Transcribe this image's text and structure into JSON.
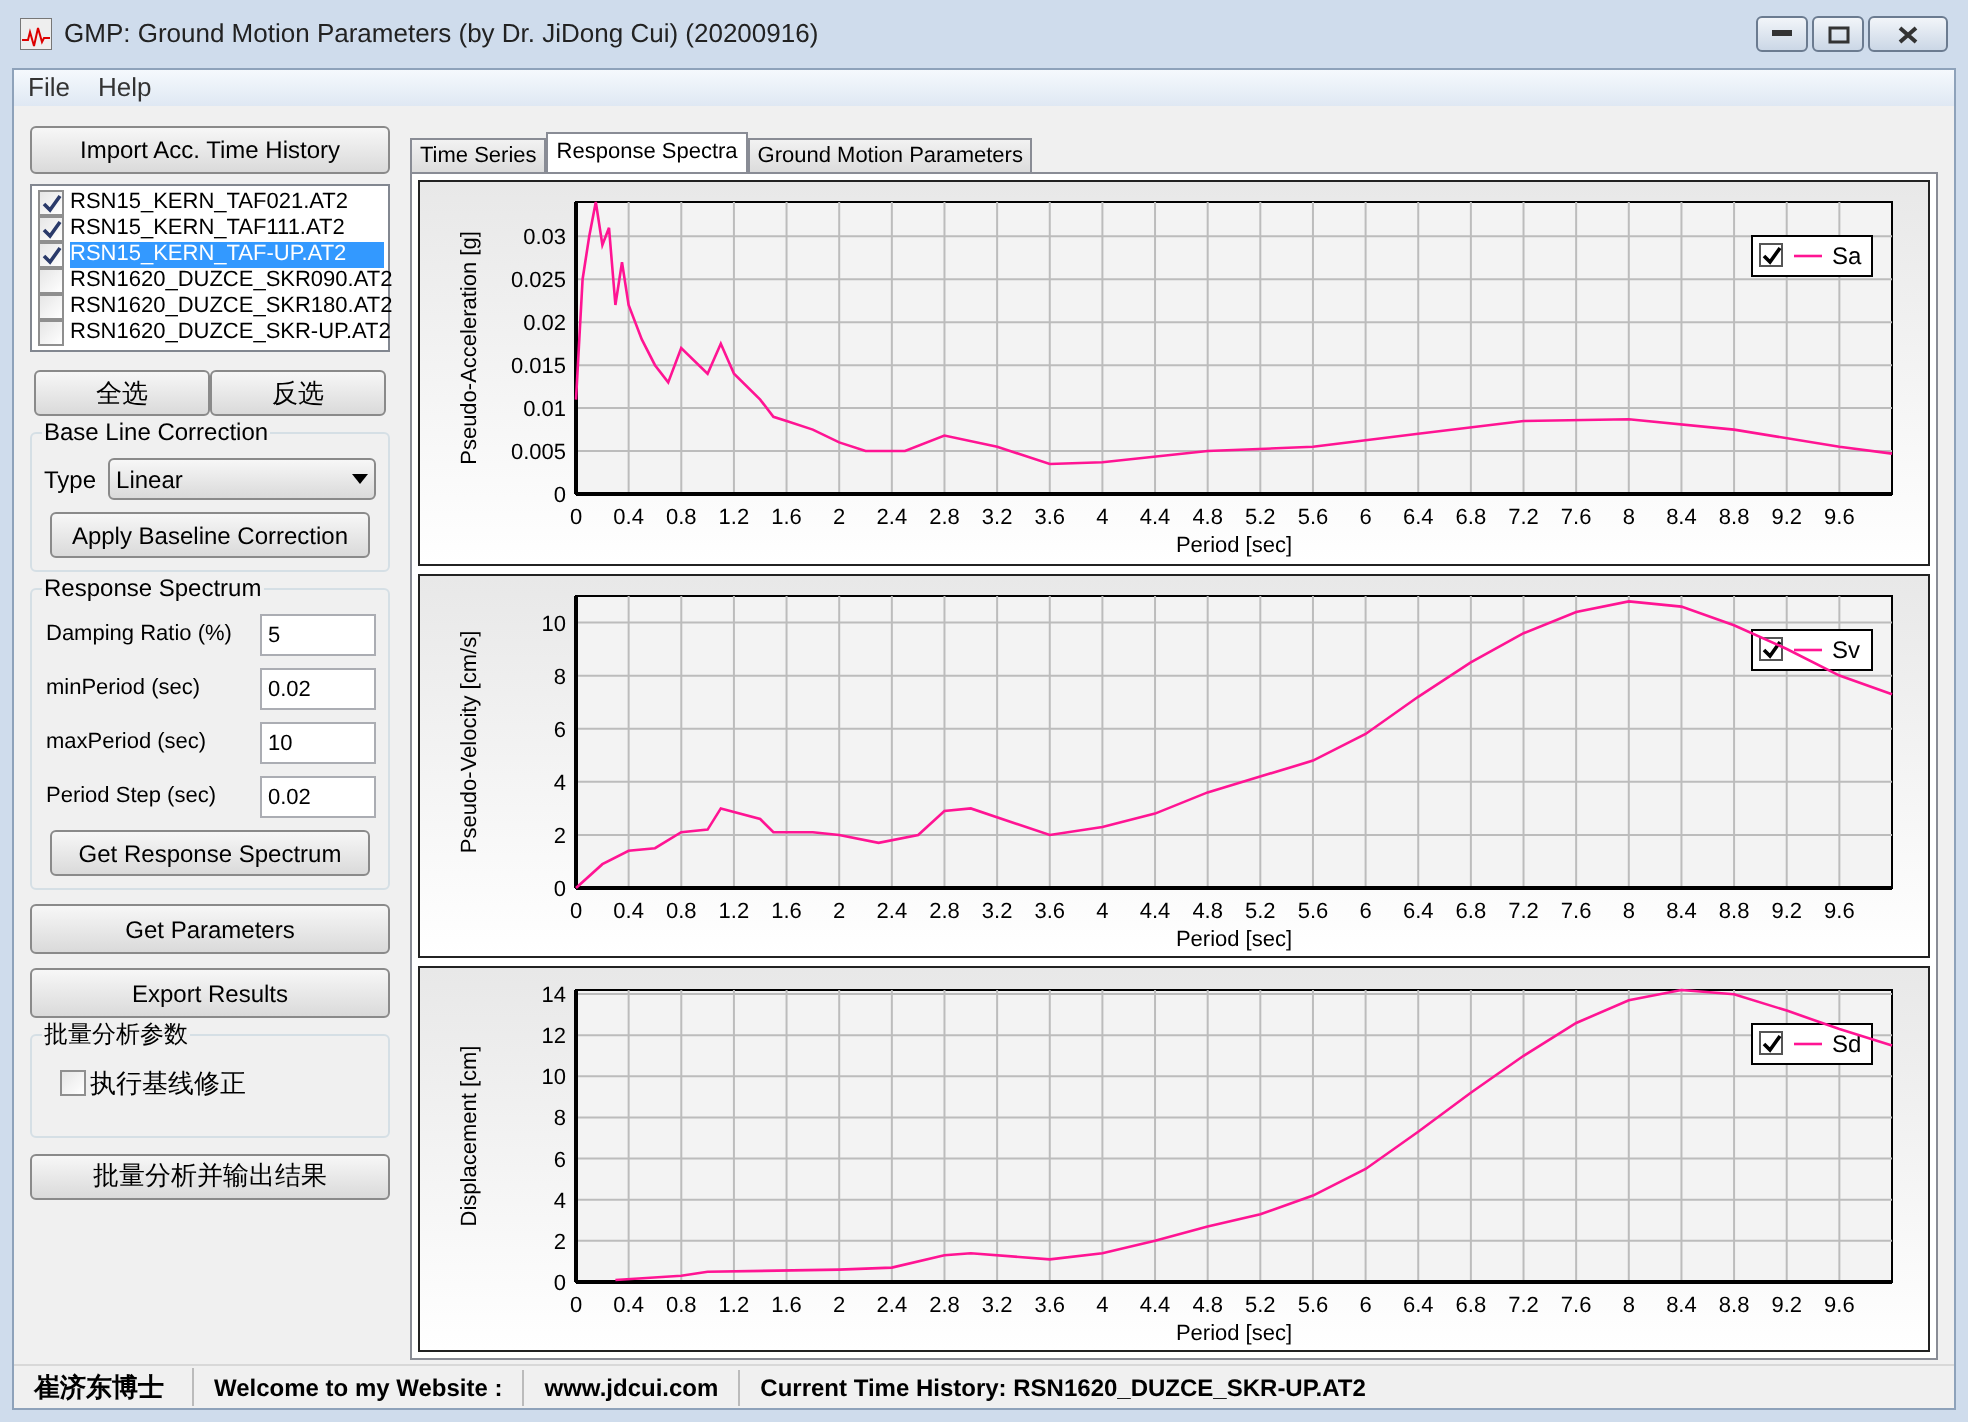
{
  "window": {
    "title": "GMP: Ground Motion Parameters (by Dr. JiDong Cui) (20200916)"
  },
  "menu": [
    "File",
    "Help"
  ],
  "left_panel": {
    "import_button": "Import Acc. Time History",
    "files": [
      {
        "name": "RSN15_KERN_TAF021.AT2",
        "checked": true,
        "selected": false
      },
      {
        "name": "RSN15_KERN_TAF111.AT2",
        "checked": true,
        "selected": false
      },
      {
        "name": "RSN15_KERN_TAF-UP.AT2",
        "checked": true,
        "selected": true
      },
      {
        "name": "RSN1620_DUZCE_SKR090.AT2",
        "checked": false,
        "selected": false
      },
      {
        "name": "RSN1620_DUZCE_SKR180.AT2",
        "checked": false,
        "selected": false
      },
      {
        "name": "RSN1620_DUZCE_SKR-UP.AT2",
        "checked": false,
        "selected": false
      }
    ],
    "select_buttons": [
      "全选",
      "反选"
    ],
    "baseline": {
      "title": "Base Line Correction",
      "type_label": "Type",
      "type_value": "Linear",
      "button": "Apply Baseline Correction"
    },
    "response_spectrum": {
      "title": "Response Spectrum",
      "fields": [
        {
          "label": "Damping Ratio (%)",
          "value": "5"
        },
        {
          "label": "minPeriod (sec)",
          "value": "0.02"
        },
        {
          "label": "maxPeriod (sec)",
          "value": "10"
        },
        {
          "label": "Period Step (sec)",
          "value": "0.02"
        }
      ],
      "button": "Get Response Spectrum"
    },
    "buttons": [
      "Get Parameters",
      "Export Results"
    ],
    "batch": {
      "title": "批量分析参数",
      "checkbox": {
        "label": "执行基线修正",
        "checked": false
      }
    },
    "batch_button": "批量分析并输出结果"
  },
  "tabs": [
    {
      "label": "Time Series",
      "selected": false
    },
    {
      "label": "Response Spectra",
      "selected": true
    },
    {
      "label": "Ground Motion Parameters",
      "selected": false
    }
  ],
  "charts": [
    {
      "legend_checked": true,
      "chart_data": {
        "type": "line",
        "grid": true,
        "xlabel": "Period [sec]",
        "ylabel": "Pseudo-Acceleration [g]",
        "x": [
          0,
          0.05,
          0.1,
          0.15,
          0.2,
          0.25,
          0.3,
          0.35,
          0.4,
          0.5,
          0.6,
          0.7,
          0.8,
          1.0,
          1.1,
          1.2,
          1.4,
          1.5,
          1.6,
          1.8,
          2.0,
          2.2,
          2.5,
          2.8,
          3.2,
          3.6,
          4,
          4.8,
          5.6,
          6.4,
          7.2,
          8,
          8.8,
          9.6,
          10
        ],
        "series": [
          {
            "name": "Sa",
            "color": "#ff1493",
            "values": [
              0.011,
              0.025,
              0.03,
              0.034,
              0.029,
              0.031,
              0.022,
              0.027,
              0.022,
              0.018,
              0.015,
              0.013,
              0.017,
              0.014,
              0.0175,
              0.014,
              0.011,
              0.009,
              0.0085,
              0.0075,
              0.006,
              0.005,
              0.005,
              0.0068,
              0.0055,
              0.0035,
              0.0037,
              0.005,
              0.0055,
              0.007,
              0.0085,
              0.0087,
              0.0075,
              0.0055,
              0.0047
            ]
          }
        ],
        "xlim": [
          0,
          10
        ],
        "ylim": [
          0,
          0.034
        ],
        "xticks": [
          0,
          0.4,
          0.8,
          1.2,
          1.6,
          2,
          2.4,
          2.8,
          3.2,
          3.6,
          4,
          4.4,
          4.8,
          5.2,
          5.6,
          6,
          6.4,
          6.8,
          7.2,
          7.6,
          8,
          8.4,
          8.8,
          9.2,
          9.6
        ],
        "yticks": [
          0,
          0.005,
          0.01,
          0.015,
          0.02,
          0.025,
          0.03
        ]
      }
    },
    {
      "legend_checked": true,
      "chart_data": {
        "type": "line",
        "grid": true,
        "xlabel": "Period [sec]",
        "ylabel": "Pseudo-Velocity [cm/s]",
        "x": [
          0,
          0.2,
          0.4,
          0.6,
          0.8,
          1.0,
          1.1,
          1.4,
          1.5,
          1.8,
          2.0,
          2.3,
          2.6,
          2.8,
          3.0,
          3.6,
          4,
          4.4,
          4.8,
          5.6,
          6,
          6.4,
          6.8,
          7.2,
          7.6,
          8,
          8.4,
          8.8,
          9.2,
          9.6,
          10
        ],
        "series": [
          {
            "name": "Sv",
            "color": "#ff1493",
            "values": [
              0,
              0.9,
              1.4,
              1.5,
              2.1,
              2.2,
              3,
              2.6,
              2.1,
              2.1,
              2,
              1.7,
              2.0,
              2.9,
              3,
              2,
              2.3,
              2.8,
              3.6,
              4.8,
              5.8,
              7.2,
              8.5,
              9.6,
              10.4,
              10.8,
              10.6,
              9.9,
              9.0,
              8.0,
              7.3
            ]
          }
        ],
        "xlim": [
          0,
          10
        ],
        "ylim": [
          0,
          11
        ],
        "xticks": [
          0,
          0.4,
          0.8,
          1.2,
          1.6,
          2,
          2.4,
          2.8,
          3.2,
          3.6,
          4,
          4.4,
          4.8,
          5.2,
          5.6,
          6,
          6.4,
          6.8,
          7.2,
          7.6,
          8,
          8.4,
          8.8,
          9.2,
          9.6
        ],
        "yticks": [
          0,
          2,
          4,
          6,
          8,
          10
        ]
      }
    },
    {
      "legend_checked": true,
      "chart_data": {
        "type": "line",
        "grid": true,
        "xlabel": "Period [sec]",
        "ylabel": "Displacement [cm]",
        "x": [
          0.3,
          0.8,
          1.0,
          2.0,
          2.4,
          2.8,
          3.0,
          3.6,
          4,
          4.4,
          4.8,
          5.2,
          5.6,
          6,
          6.4,
          6.8,
          7.2,
          7.6,
          8,
          8.4,
          8.8,
          9.2,
          9.6,
          10
        ],
        "series": [
          {
            "name": "Sd",
            "color": "#ff1493",
            "values": [
              0.1,
              0.3,
              0.5,
              0.6,
              0.7,
              1.3,
              1.4,
              1.1,
              1.4,
              2,
              2.7,
              3.3,
              4.2,
              5.5,
              7.3,
              9.2,
              11,
              12.6,
              13.7,
              14.2,
              14,
              13.2,
              12.3,
              11.5
            ]
          }
        ],
        "xlim": [
          0,
          10
        ],
        "ylim": [
          0,
          14.2
        ],
        "xticks": [
          0,
          0.4,
          0.8,
          1.2,
          1.6,
          2,
          2.4,
          2.8,
          3.2,
          3.6,
          4,
          4.4,
          4.8,
          5.2,
          5.6,
          6,
          6.4,
          6.8,
          7.2,
          7.6,
          8,
          8.4,
          8.8,
          9.2,
          9.6
        ],
        "yticks": [
          0,
          2,
          4,
          6,
          8,
          10,
          12,
          14
        ]
      }
    }
  ],
  "status_bar": [
    "崔济东博士",
    "Welcome to my Website :",
    "www.jdcui.com",
    "Current Time History: RSN1620_DUZCE_SKR-UP.AT2"
  ]
}
